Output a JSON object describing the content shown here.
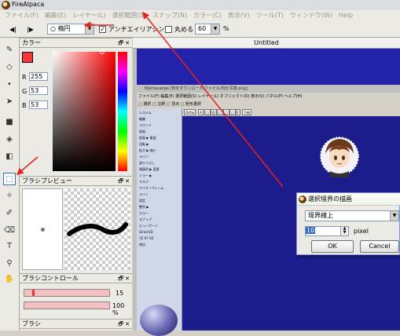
{
  "app": {
    "title": "FireAlpaca",
    "menu": [
      "ファイル(F)",
      "編集(E)",
      "レイヤー(L)",
      "選択範囲(S)",
      "スナップ(N)",
      "カラー(C)",
      "表示(V)",
      "ツール(T)",
      "ウィンドウ(W)",
      "Help"
    ]
  },
  "toolbar": {
    "prev_icon": "◀|",
    "next_icon": "|▶",
    "shape_value": "○ 楕円",
    "antialias_label": "アンチエイリアシング",
    "antialias_checked": "✓",
    "round_label": "丸める",
    "round_value": "60",
    "round_unit": "%"
  },
  "color_panel": {
    "title": "カラー",
    "r_label": "R",
    "r_value": "255",
    "g_label": "G",
    "g_value": "53",
    "b_label": "B",
    "b_value": "53",
    "foreground": "#ff3535",
    "background": "#ffffff"
  },
  "brush_preview": {
    "title": "ブラシプレビュー"
  },
  "brush_control": {
    "title": "ブラシコントロール",
    "size_value": "15",
    "opacity_value": "100 %"
  },
  "brush_panel": {
    "title": "ブラシ"
  },
  "document": {
    "tab_title": "Untitled"
  },
  "inner_app": {
    "title": "Nijimasaoga [何をダウンロード/ファイル/何か写真.png]",
    "menu": "ファイル(F)  編集(E)  選択範囲(S)  レイヤー(L)  オブジェクト(O)  表示(V)  パネル(P)  ヘルプ(H)",
    "bar": "□ 選択  □ 注釈  □ 頂点  □ 矩形選択",
    "tabs": [
      "Ortho",
      "A",
      "□",
      "回",
      "□",
      "□",
      "□",
      "F",
      "下絵"
    ],
    "side_rows": [
      "システム",
      "編集",
      "コマンド",
      "描画",
      "前面 ▶ 後面",
      "回転 ▶",
      "拡大 ▶ 縮小",
      "ライン",
      "塗りつぶし",
      "描画色 ▶ 変更",
      "ミラー ▶",
      "マスク",
      "ワイヤーフレーム",
      "ライト",
      "設定",
      "整列 ▶",
      "カラー",
      "スナップ",
      "ビューポート",
      "Direct3D",
      "YZ XY XZ",
      "視点"
    ]
  },
  "dialog": {
    "title": "選択境界の描画",
    "mode_value": "境界線上",
    "width_value": "10",
    "width_unit": "pixel",
    "ok_label": "OK",
    "cancel_label": "Cancel"
  }
}
